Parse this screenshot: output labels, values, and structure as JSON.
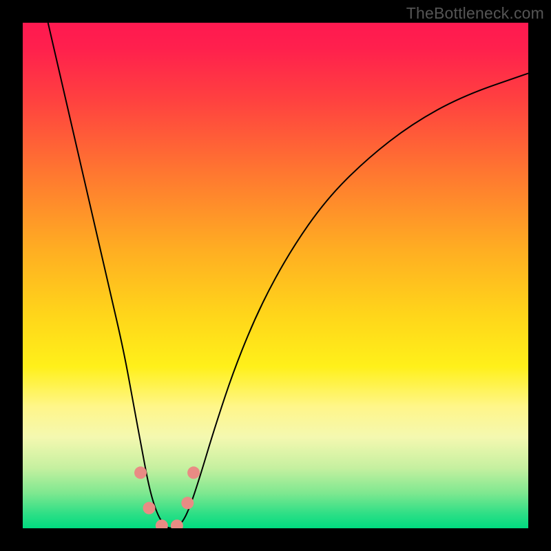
{
  "watermark": "TheBottleneck.com",
  "chart_data": {
    "type": "line",
    "title": "",
    "xlabel": "",
    "ylabel": "",
    "xlim": [
      0,
      100
    ],
    "ylim": [
      0,
      100
    ],
    "background_gradient": {
      "stops": [
        {
          "offset": 0.0,
          "color": "#ff1950"
        },
        {
          "offset": 0.05,
          "color": "#ff204d"
        },
        {
          "offset": 0.15,
          "color": "#ff4040"
        },
        {
          "offset": 0.3,
          "color": "#ff7830"
        },
        {
          "offset": 0.45,
          "color": "#ffae22"
        },
        {
          "offset": 0.58,
          "color": "#ffd61a"
        },
        {
          "offset": 0.68,
          "color": "#fff01a"
        },
        {
          "offset": 0.76,
          "color": "#fff68a"
        },
        {
          "offset": 0.82,
          "color": "#f4f8b0"
        },
        {
          "offset": 0.88,
          "color": "#c6f0a0"
        },
        {
          "offset": 0.93,
          "color": "#7fe890"
        },
        {
          "offset": 0.97,
          "color": "#30df86"
        },
        {
          "offset": 1.0,
          "color": "#00db80"
        }
      ]
    },
    "series": [
      {
        "name": "bottleneck-curve",
        "type": "line",
        "color": "#000000",
        "width": 2.0,
        "x": [
          5,
          8,
          11,
          14,
          17,
          20,
          22,
          23.5,
          25,
          26.5,
          28,
          29,
          30,
          31.5,
          33,
          35,
          38,
          42,
          47,
          53,
          60,
          68,
          77,
          87,
          100
        ],
        "y": [
          100,
          87,
          74,
          61,
          48,
          35,
          24,
          16,
          8,
          3,
          0.5,
          0,
          0,
          1,
          4,
          10,
          20,
          32,
          44,
          55,
          65,
          73,
          80,
          85.5,
          90
        ]
      }
    ],
    "markers": {
      "name": "highlight-dots",
      "color": "#e98b84",
      "r": 9,
      "points": [
        {
          "x": 23.3,
          "y": 11
        },
        {
          "x": 25.0,
          "y": 4
        },
        {
          "x": 27.5,
          "y": 0.5
        },
        {
          "x": 30.5,
          "y": 0.5
        },
        {
          "x": 32.6,
          "y": 5
        },
        {
          "x": 33.8,
          "y": 11
        }
      ]
    }
  }
}
